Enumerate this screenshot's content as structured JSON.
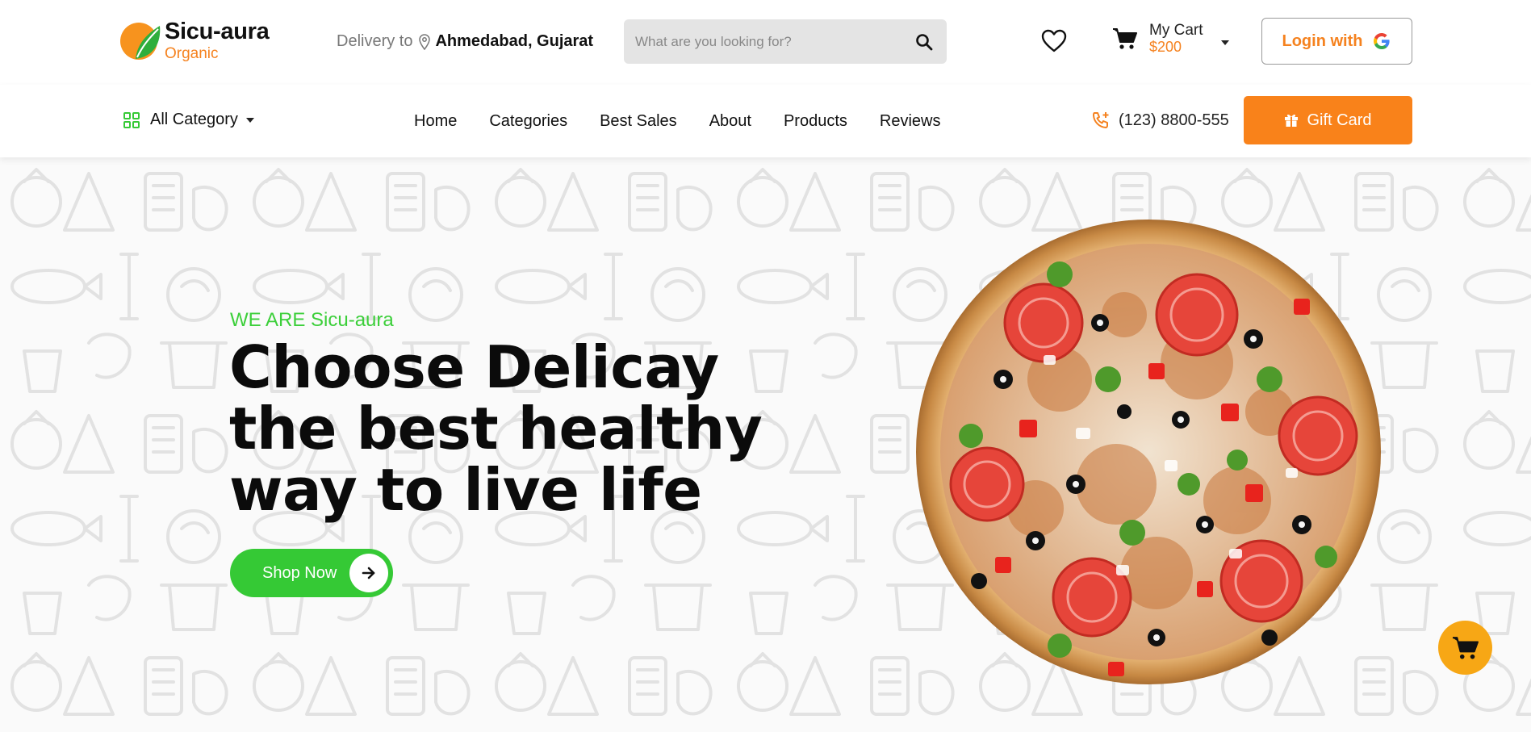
{
  "brand": {
    "name": "Sicu-aura",
    "tagline": "Organic"
  },
  "delivery": {
    "label": "Delivery to",
    "location": "Ahmedabad, Gujarat"
  },
  "search": {
    "placeholder": "What are you looking for?"
  },
  "cart": {
    "label": "My Cart",
    "amount": "$200"
  },
  "login": {
    "label": "Login with"
  },
  "category_menu": {
    "label": "All Category"
  },
  "nav": {
    "items": [
      {
        "label": "Home"
      },
      {
        "label": "Categories"
      },
      {
        "label": "Best Sales"
      },
      {
        "label": "About"
      },
      {
        "label": "Products"
      },
      {
        "label": "Reviews"
      }
    ]
  },
  "contact": {
    "phone": "(123) 8800-555"
  },
  "gift_card": {
    "label": "Gift Card"
  },
  "hero": {
    "tag": "WE ARE Sicu-aura",
    "title_lines": [
      "Choose Delicay",
      "the best healthy",
      "way to live life"
    ],
    "cta": "Shop Now"
  },
  "colors": {
    "accent_orange": "#f5821f",
    "accent_green": "#35c935",
    "floating_cart": "#f7a715"
  }
}
